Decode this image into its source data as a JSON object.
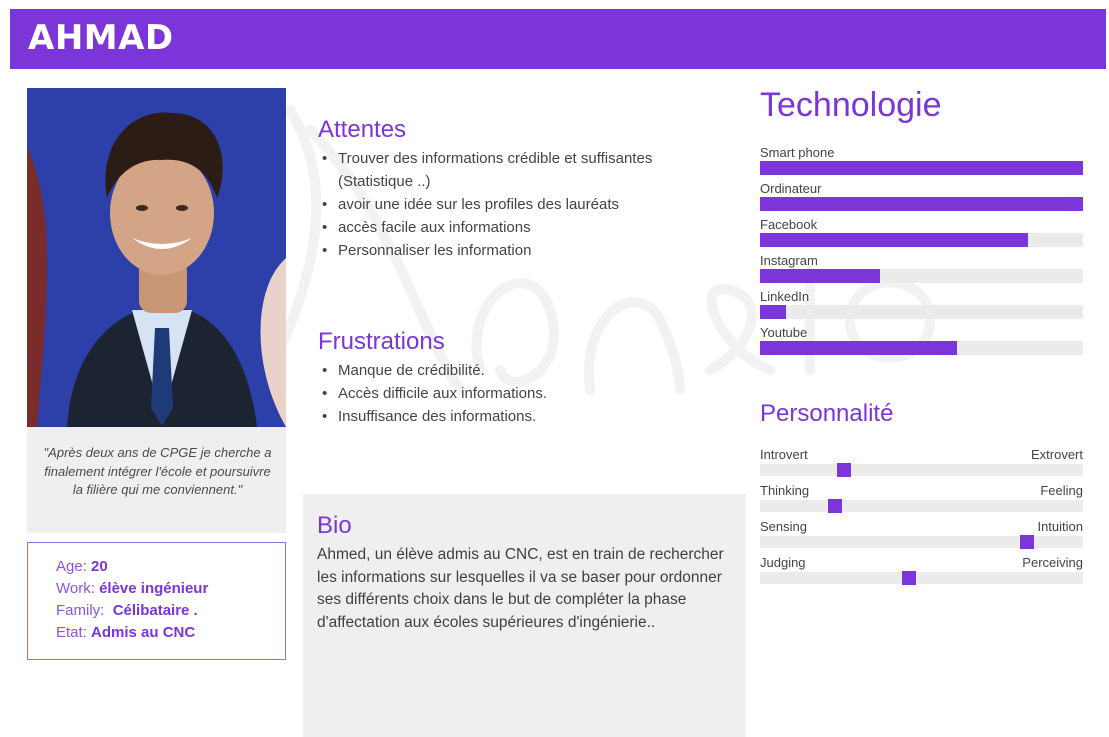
{
  "header": {
    "name": "AHMAD"
  },
  "colors": {
    "accent": "#7b35d8",
    "track": "#ebebeb",
    "panel": "#efefef"
  },
  "quote": "\"Après deux ans de CPGE je cherche a finalement intégrer l'école et poursuivre la filière qui me conviennent.\"",
  "info": {
    "age_label": "Age:",
    "age_value": "20",
    "work_label": "Work:",
    "work_value": "élève ingénieur",
    "family_label": "Family:",
    "family_value": "Célibataire .",
    "etat_label": "Etat:",
    "etat_value": "Admis au CNC"
  },
  "attentes": {
    "title": "Attentes",
    "items": [
      "Trouver des informations crédible et suffisantes (Statistique ..)",
      "avoir une idée sur les profiles des lauréats",
      "accès facile aux informations",
      "Personnaliser les information"
    ]
  },
  "frustrations": {
    "title": "Frustrations",
    "items": [
      "Manque de crédibilité.",
      "Accès difficile aux informations.",
      "Insuffisance des informations."
    ]
  },
  "bio": {
    "title": "Bio",
    "text": "Ahmed, un élève admis au CNC, est en train de rechercher les informations sur lesquelles il va se baser pour ordonner ses différents choix dans le but de compléter la phase d'affectation aux écoles supérieures d'ingénierie.."
  },
  "technologie": {
    "title": "Technologie",
    "items": [
      {
        "label": "Smart phone",
        "level": 1.0
      },
      {
        "label": "Ordinateur",
        "level": 1.0
      },
      {
        "label": "Facebook",
        "level": 0.83
      },
      {
        "label": "Instagram",
        "level": 0.37
      },
      {
        "label": "LinkedIn",
        "level": 0.08
      },
      {
        "label": "Youtube",
        "level": 0.61
      }
    ]
  },
  "personnalite": {
    "title": "Personnalité",
    "items": [
      {
        "left": "Introvert",
        "right": "Extrovert",
        "position": 0.25
      },
      {
        "left": "Thinking",
        "right": "Feeling",
        "position": 0.22
      },
      {
        "left": "Sensing",
        "right": "Intuition",
        "position": 0.84
      },
      {
        "left": "Judging",
        "right": "Perceiving",
        "position": 0.46
      }
    ]
  }
}
